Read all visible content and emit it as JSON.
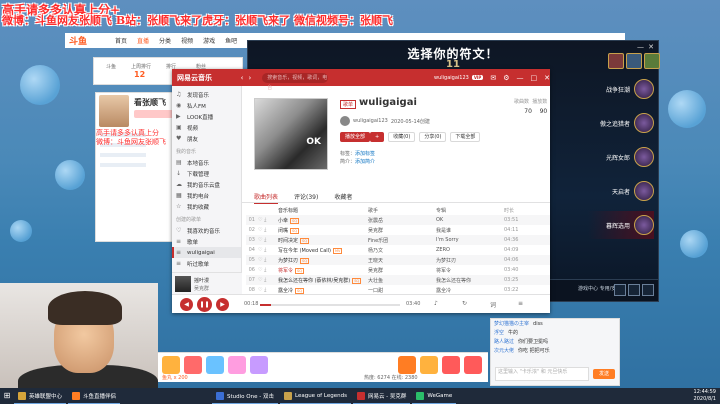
{
  "overlay": {
    "line1": "高手请多多认真上分+",
    "line2": "微博：斗鱼网友张顺飞 B站：张顺飞来了虎牙：张顺飞来了 微信视频号：张顺飞",
    "card_line1": "高手请多多认真上分",
    "card_line2": "微博：斗鱼网友张顺飞"
  },
  "site": {
    "logo": "斗鱼",
    "nav": [
      "首页",
      "直播",
      "分类",
      "视频",
      "游戏",
      "鱼吧"
    ]
  },
  "left_panel": {
    "labels": [
      "斗鱼",
      "上周排行",
      "排行",
      "粉丝"
    ],
    "count": "12",
    "anchor_name": "看张顺飞"
  },
  "lol": {
    "title": "选择你的符文！",
    "timer": "11",
    "slots": [
      {
        "label": "战争狂潮"
      },
      {
        "label": "傲之追猎者"
      },
      {
        "label": "光辉女郎"
      },
      {
        "label": "天启者"
      },
      {
        "label": "暮辉选用",
        "active": true
      }
    ],
    "bottom_text": "游戏中心 专用/安排"
  },
  "music": {
    "app_name": "网易云音乐",
    "search_placeholder": "搜索音乐，视频，歌词，电台",
    "user": "wuligaigai123",
    "vip": "VIP",
    "sidebar": {
      "group1": [
        {
          "icon": "♫",
          "label": "发现音乐"
        },
        {
          "icon": "◉",
          "label": "私人FM"
        },
        {
          "icon": "▶",
          "label": "LOOK直播"
        },
        {
          "icon": "▣",
          "label": "视频"
        },
        {
          "icon": "♥",
          "label": "朋友"
        }
      ],
      "group2_head": "我的音乐",
      "group2": [
        {
          "icon": "▤",
          "label": "本地音乐"
        },
        {
          "icon": "↓",
          "label": "下载管理"
        },
        {
          "icon": "☁",
          "label": "我的音乐云盘"
        },
        {
          "icon": "▦",
          "label": "我的电台"
        },
        {
          "icon": "☆",
          "label": "我的收藏"
        }
      ],
      "group3_head": "创建的歌单",
      "group3": [
        {
          "icon": "♡",
          "label": "我喜欢的音乐"
        },
        {
          "icon": "≡",
          "label": "歌单"
        },
        {
          "icon": "≡",
          "label": "wuligaigai"
        },
        {
          "icon": "≡",
          "label": "听过歌单"
        }
      ]
    },
    "now_playing": {
      "title": "摇叶漫",
      "artist": "吴克群"
    },
    "playlist": {
      "tag": "歌单",
      "title": "wuligaigai",
      "owner": "wuligaigai123",
      "created": "2020-05-14创建",
      "stats_labels": [
        "歌曲数",
        "播放数"
      ],
      "stats_values": [
        "70",
        "90"
      ],
      "buttons": [
        "播放全部",
        "+",
        "收藏(0)",
        "分享(0)",
        "下载全部"
      ],
      "tags_label": "标签：",
      "tags_value": "添加标签",
      "desc_label": "简介：",
      "desc_value": "添加简介"
    },
    "tabs": [
      "歌曲列表",
      "评论(39)",
      "收藏者"
    ],
    "columns": [
      "音乐标题",
      "歌手",
      "专辑",
      "时长"
    ],
    "tracks": [
      {
        "idx": "01",
        "title": "小幸",
        "artist": "张震岳",
        "album": "OK",
        "dur": "03:51",
        "badge": "SQ"
      },
      {
        "idx": "02",
        "title": "闭嘴",
        "artist": "吴克群",
        "album": "我是谁",
        "dur": "04:11",
        "badge": "SQ"
      },
      {
        "idx": "03",
        "title": "时间决定",
        "artist": "Fine乐团",
        "album": "I'm Sorry",
        "dur": "04:36",
        "badge": "SQ"
      },
      {
        "idx": "04",
        "title": "写在今年 (Moved Call)",
        "artist": "杨乃文",
        "album": "ZERO",
        "dur": "04:09",
        "badge": "MV"
      },
      {
        "idx": "05",
        "title": "为梦扛刃",
        "artist": "王晓天",
        "album": "为梦扛刃",
        "dur": "04:06",
        "badge": "SQ"
      },
      {
        "idx": "06",
        "title": "将军令",
        "artist": "吴克群",
        "album": "将军令",
        "dur": "03:40",
        "badge": "SQ",
        "playing": true
      },
      {
        "idx": "07",
        "title": "我怎么还在等你 (蔡依林/吴克群)",
        "artist": "大壮鱼",
        "album": "我怎么还在等你",
        "dur": "03:25",
        "badge": "SQ"
      },
      {
        "idx": "08",
        "title": "露全冷",
        "artist": "一口甜",
        "album": "露全冷",
        "dur": "03:22",
        "badge": "SQ"
      }
    ],
    "player": {
      "current": "00:18",
      "total": "03:40",
      "progress": 0.08
    }
  },
  "chat": {
    "rows": [
      {
        "who": "梦幻猫猫の主宰",
        "msg": "diss"
      },
      {
        "who": "浮空",
        "msg": "牛的"
      },
      {
        "who": "路人路过",
        "msg": "你们要卫冕吗"
      },
      {
        "who": "次元大佬",
        "msg": "你吃 把把可乐"
      }
    ],
    "input_placeholder": "这里输入 \"卡乐浓\" 和 元旦快乐",
    "send": "发送"
  },
  "gift_bar": {
    "balance": "鱼丸 x 200",
    "stat": "热度: 6274   在线: 2380"
  },
  "taskbar": {
    "items": [
      {
        "label": "英雄联盟中心",
        "color": "#d4a43b"
      },
      {
        "label": "斗鱼直播伴侣",
        "color": "#ff7d23"
      },
      {
        "label": "Studio One - 双击",
        "color": "#3b6fd4"
      },
      {
        "label": "League of Legends",
        "color": "#c7a14b"
      },
      {
        "label": "网易云 - 吴克群",
        "color": "#c62f2f"
      },
      {
        "label": "WeGame",
        "color": "#2bbf6a"
      }
    ],
    "time": "12:44:59",
    "date": "2020/8/1"
  }
}
